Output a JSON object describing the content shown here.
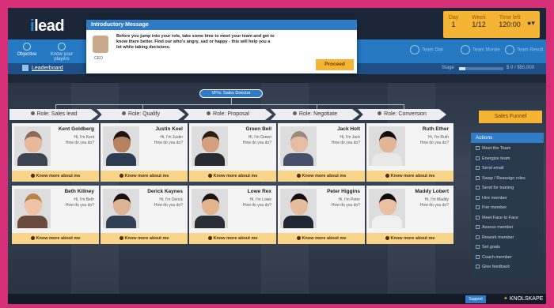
{
  "app": {
    "logo_prefix": "i",
    "logo_rest": "lead"
  },
  "stats": {
    "day_label": "Day",
    "day_value": "1",
    "week_label": "Week",
    "week_value": "1/12",
    "time_label": "Time left",
    "time_value": "120:00"
  },
  "nav": {
    "items": [
      {
        "label": "Objective",
        "icon": "target-icon"
      },
      {
        "label": "Know your players",
        "icon": "people-icon"
      }
    ],
    "right_items": [
      {
        "label": "Team Dial",
        "icon": "dial-icon"
      },
      {
        "label": "Team Morale",
        "icon": "morale-icon"
      },
      {
        "label": "Team Result",
        "icon": "result-icon"
      }
    ]
  },
  "subbar": {
    "leaderboard": "Leaderboard",
    "progress_label": "Stage",
    "progress_fraction": 0.15,
    "progress_value": "$ 0 / $50,000"
  },
  "dialog": {
    "title": "Introductory Message",
    "text": "Before you jump into your role, take some time to meet your team and get to know them better. Find our who's angry, sad or happy - this will help you a lot while taking decisions.",
    "avatar_label": "CEO",
    "proceed": "Proceed"
  },
  "org": {
    "vp": "VP/s: Sales Director"
  },
  "roles": [
    "Role: Sales lead",
    "Role: Qualify",
    "Role: Proposal",
    "Role: Negotiate",
    "Role: Conversion"
  ],
  "card_button": "Know more about me",
  "greet_line2": "How do you do?",
  "cards": [
    {
      "name": "Kent Goldberg",
      "greet": "Hi, I'm Kent",
      "skin": "#e7b89b",
      "hair": "#8a6a55",
      "shirt": "#3b4450"
    },
    {
      "name": "Justin Keel",
      "greet": "Hi, I'm Justin",
      "skin": "#b8815e",
      "hair": "#1b1410",
      "shirt": "#2c3a52"
    },
    {
      "name": "Green Bell",
      "greet": "Hi, I'm Green",
      "skin": "#d49f7e",
      "hair": "#2a1d15",
      "shirt": "#262a31"
    },
    {
      "name": "Jack Holt",
      "greet": "Hi, I'm Jack",
      "skin": "#e6bca4",
      "hair": "#9c8a80",
      "shirt": "#47506a"
    },
    {
      "name": "Ruth Ether",
      "greet": "Hi, I'm Ruth",
      "skin": "#e3b597",
      "hair": "#120d0b",
      "shirt": "#e8e8e8"
    },
    {
      "name": "Beth Killney",
      "greet": "Hi, I'm Beth",
      "skin": "#eec3a6",
      "hair": "#b88449",
      "shirt": "#6a4a3c"
    },
    {
      "name": "Derick Kaynes",
      "greet": "Hi, I'm Derick",
      "skin": "#dcb394",
      "hair": "#161110",
      "shirt": "#324055"
    },
    {
      "name": "Lowe Rex",
      "greet": "Hi, I'm Lowe",
      "skin": "#e2b58f",
      "hair": "#1d1510",
      "shirt": "#2a2e36"
    },
    {
      "name": "Peter Higgins",
      "greet": "Hi, I'm Peter",
      "skin": "#e6bd9c",
      "hair": "#15100d",
      "shirt": "#1f2733"
    },
    {
      "name": "Maddy Lobert",
      "greet": "Hi, I'm Maddy",
      "skin": "#e9c0a3",
      "hair": "#0f0b0a",
      "shirt": "#f0f0f0"
    }
  ],
  "funnel": "Sales Funnel",
  "actions": {
    "title": "Actions",
    "items": [
      "Meet the Team",
      "Energize team",
      "Send email",
      "Swap / Reassign roles",
      "Send for training",
      "Hire member",
      "Fire member",
      "Meet Face to Face",
      "Assess member",
      "Rework member",
      "Set goals",
      "Coach member",
      "Give feedback"
    ]
  },
  "footer": {
    "support": "Support",
    "brand": "KNOLSKAPE"
  },
  "colors": {
    "accent": "#2f7bc6",
    "highlight": "#f5b433",
    "frame": "#d62f78"
  }
}
